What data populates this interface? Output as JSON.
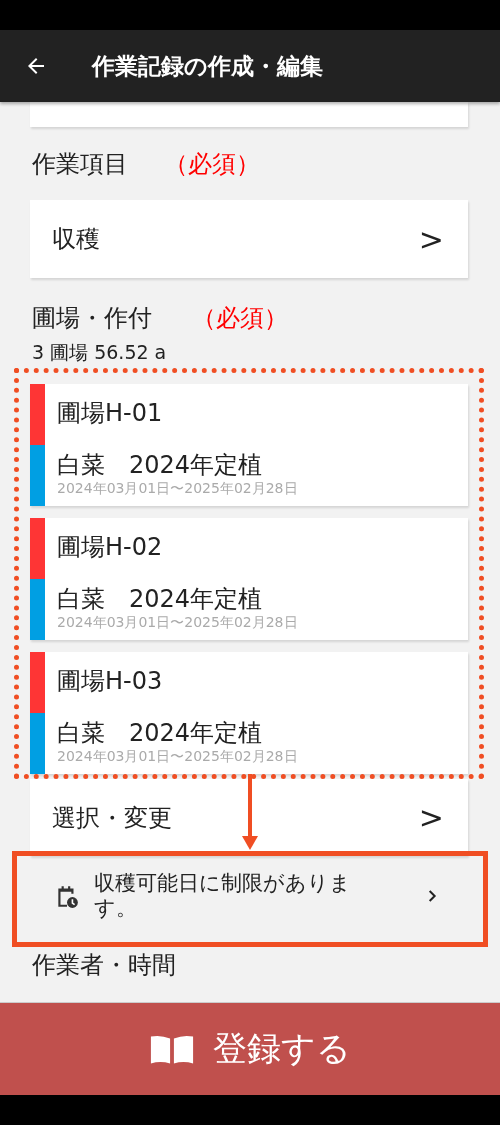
{
  "app_bar": {
    "title": "作業記録の作成・編集"
  },
  "work_item": {
    "label": "作業項目",
    "required": "（必須）",
    "value": "収穫",
    "chevron": ">"
  },
  "fields": {
    "label": "圃場・作付",
    "required": "（必須）",
    "summary": "3 圃場 56.52 a",
    "items": [
      {
        "name": "圃場H-01",
        "crop": "白菜　2024年定植",
        "period": "2024年03月01日〜2025年02月28日"
      },
      {
        "name": "圃場H-02",
        "crop": "白菜　2024年定植",
        "period": "2024年03月01日〜2025年02月28日"
      },
      {
        "name": "圃場H-03",
        "crop": "白菜　2024年定植",
        "period": "2024年03月01日〜2025年02月28日"
      }
    ],
    "select_button": {
      "label": "選択・変更",
      "chevron": ">"
    }
  },
  "notice": {
    "text": "収穫可能日に制限があります。"
  },
  "workers": {
    "label": "作業者・時間"
  },
  "submit": {
    "label": "登録する"
  }
}
